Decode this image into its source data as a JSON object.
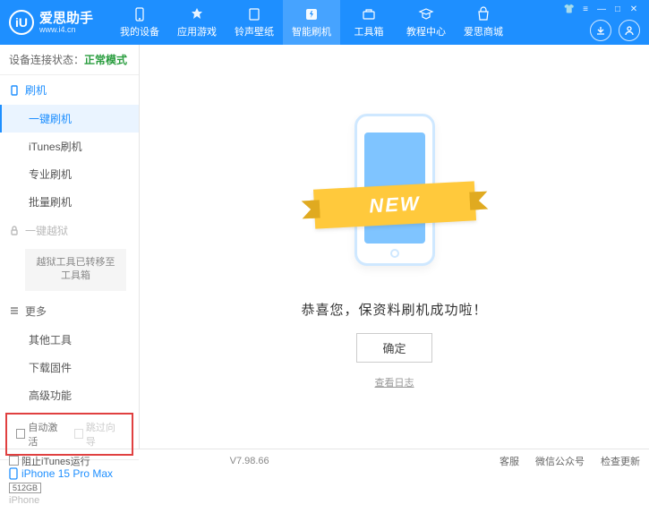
{
  "app": {
    "name": "爱思助手",
    "url": "www.i4.cn",
    "logo_letter": "iU"
  },
  "nav": [
    {
      "label": "我的设备"
    },
    {
      "label": "应用游戏"
    },
    {
      "label": "铃声壁纸"
    },
    {
      "label": "智能刷机",
      "active": true
    },
    {
      "label": "工具箱"
    },
    {
      "label": "教程中心"
    },
    {
      "label": "爱思商城"
    }
  ],
  "status": {
    "label": "设备连接状态：",
    "value": "正常模式"
  },
  "sidebar": {
    "flash_section": "刷机",
    "items_flash": [
      {
        "label": "一键刷机",
        "active": true
      },
      {
        "label": "iTunes刷机"
      },
      {
        "label": "专业刷机"
      },
      {
        "label": "批量刷机"
      }
    ],
    "jailbreak_section": "一键越狱",
    "jailbreak_note": "越狱工具已转移至工具箱",
    "more_section": "更多",
    "items_more": [
      {
        "label": "其他工具"
      },
      {
        "label": "下载固件"
      },
      {
        "label": "高级功能"
      }
    ],
    "auto_activate": "自动激活",
    "skip_guide": "跳过向导"
  },
  "device": {
    "name": "iPhone 15 Pro Max",
    "storage": "512GB",
    "type": "iPhone"
  },
  "main": {
    "ribbon": "NEW",
    "success": "恭喜您，保资料刷机成功啦！",
    "ok": "确定",
    "view_log": "查看日志"
  },
  "footer": {
    "block_itunes": "阻止iTunes运行",
    "version": "V7.98.66",
    "service": "客服",
    "wechat": "微信公众号",
    "update": "检查更新"
  }
}
